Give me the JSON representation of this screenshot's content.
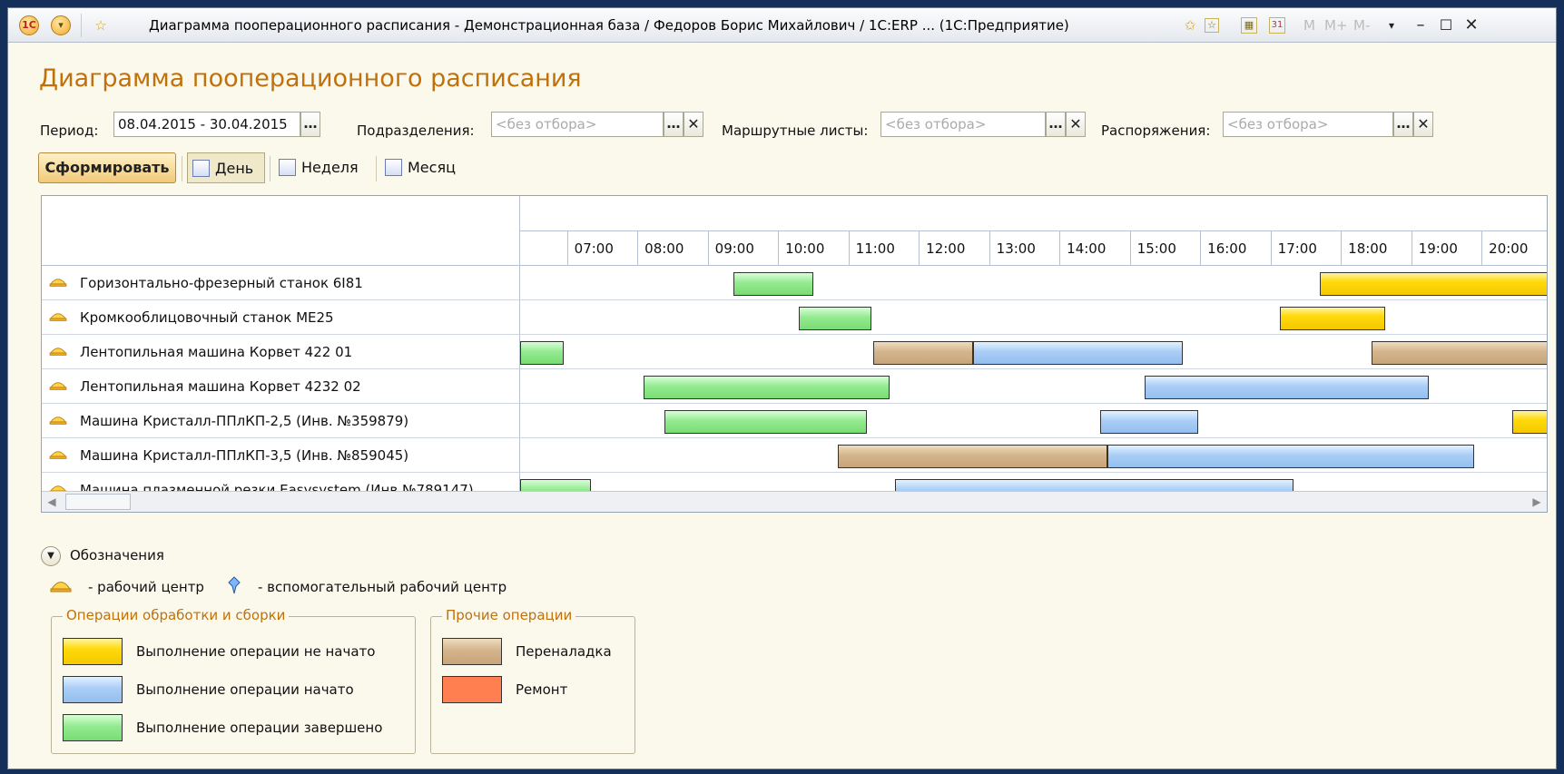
{
  "window": {
    "title": "Диаграмма пооперационного расписания - Демонстрационная база / Федоров Борис Михайлович / 1С:ERP ...  (1С:Предприятие)",
    "icons": [
      "logo-icon",
      "menu-icon",
      "favorite-star-icon",
      "add-favorite-icon",
      "favorites-list-icon",
      "calculator-icon",
      "calendar-icon"
    ],
    "calendar_day": "31",
    "memory_buttons": [
      "M",
      "M+",
      "M-"
    ],
    "controls": [
      "minimize",
      "maximize",
      "close"
    ]
  },
  "page_title": "Диаграмма пооперационного расписания",
  "filters": {
    "period_label": "Период:",
    "period_value": "08.04.2015 - 30.04.2015",
    "divisions_label": "Подразделения:",
    "routes_label": "Маршрутные листы:",
    "orders_label": "Распоряжения:",
    "placeholder": "<без отбора>"
  },
  "toolbar": {
    "generate": "Сформировать",
    "day": "День",
    "week": "Неделя",
    "month": "Месяц",
    "active_view": "day"
  },
  "chart_data": {
    "type": "gantt",
    "hours": [
      "07:00",
      "08:00",
      "09:00",
      "10:00",
      "11:00",
      "12:00",
      "13:00",
      "14:00",
      "15:00",
      "16:00",
      "17:00",
      "18:00",
      "19:00",
      "20:00"
    ],
    "colors": {
      "yellow": "#ffd90a",
      "blue": "#a9cdf6",
      "green": "#93ea8f",
      "tan": "#d4b48c",
      "red": "#ff7f50"
    },
    "rows": [
      {
        "name": "Горизонтально-фрезерный станок 6I81",
        "bars": [
          {
            "start": "09:22",
            "end": "10:30",
            "kind": "green"
          },
          {
            "start": "17:42",
            "end": "21:00",
            "kind": "yellow"
          }
        ]
      },
      {
        "name": "Кромкооблицовочный станок МЕ25",
        "bars": [
          {
            "start": "10:18",
            "end": "11:20",
            "kind": "green"
          },
          {
            "start": "17:08",
            "end": "18:38",
            "kind": "yellow"
          }
        ]
      },
      {
        "name": "Лентопильная машина Корвет 422 01",
        "bars": [
          {
            "start": "06:20",
            "end": "06:57",
            "kind": "green"
          },
          {
            "start": "11:21",
            "end": "12:46",
            "kind": "tan"
          },
          {
            "start": "12:46",
            "end": "15:45",
            "kind": "blue"
          },
          {
            "start": "18:26",
            "end": "21:00",
            "kind": "tan"
          }
        ]
      },
      {
        "name": "Лентопильная машина Корвет 4232 02",
        "bars": [
          {
            "start": "08:05",
            "end": "11:35",
            "kind": "green"
          },
          {
            "start": "15:13",
            "end": "19:15",
            "kind": "blue"
          }
        ]
      },
      {
        "name": "Машина Кристалл-ППлКП-2,5 (Инв. №359879)",
        "bars": [
          {
            "start": "08:23",
            "end": "11:16",
            "kind": "green"
          },
          {
            "start": "14:35",
            "end": "15:58",
            "kind": "blue"
          },
          {
            "start": "20:26",
            "end": "21:00",
            "kind": "yellow"
          }
        ]
      },
      {
        "name": "Машина Кристалл-ППлКП-3,5 (Инв. №859045)",
        "bars": [
          {
            "start": "10:51",
            "end": "14:41",
            "kind": "tan"
          },
          {
            "start": "14:41",
            "end": "19:54",
            "kind": "blue"
          }
        ]
      },
      {
        "name": "Машина плазменной резки Easysystem (Инв.№789147)",
        "bars": [
          {
            "start": "06:20",
            "end": "07:20",
            "kind": "green"
          },
          {
            "start": "11:40",
            "end": "17:20",
            "kind": "blue"
          }
        ]
      }
    ]
  },
  "legend": {
    "title": "Обозначения",
    "work_center": "- рабочий центр",
    "aux_work_center": "- вспомогательный рабочий центр",
    "group1_title": "Операции обработки и сборки",
    "group1": [
      {
        "label": "Выполнение операции не начато",
        "color": "#ffd90a"
      },
      {
        "label": "Выполнение операции начато",
        "color": "#a9cdf6"
      },
      {
        "label": "Выполнение операции завершено",
        "color": "#93ea8f"
      }
    ],
    "group2_title": "Прочие операции",
    "group2": [
      {
        "label": "Переналадка",
        "color": "#d4b48c"
      },
      {
        "label": "Ремонт",
        "color": "#ff7f50"
      }
    ]
  }
}
